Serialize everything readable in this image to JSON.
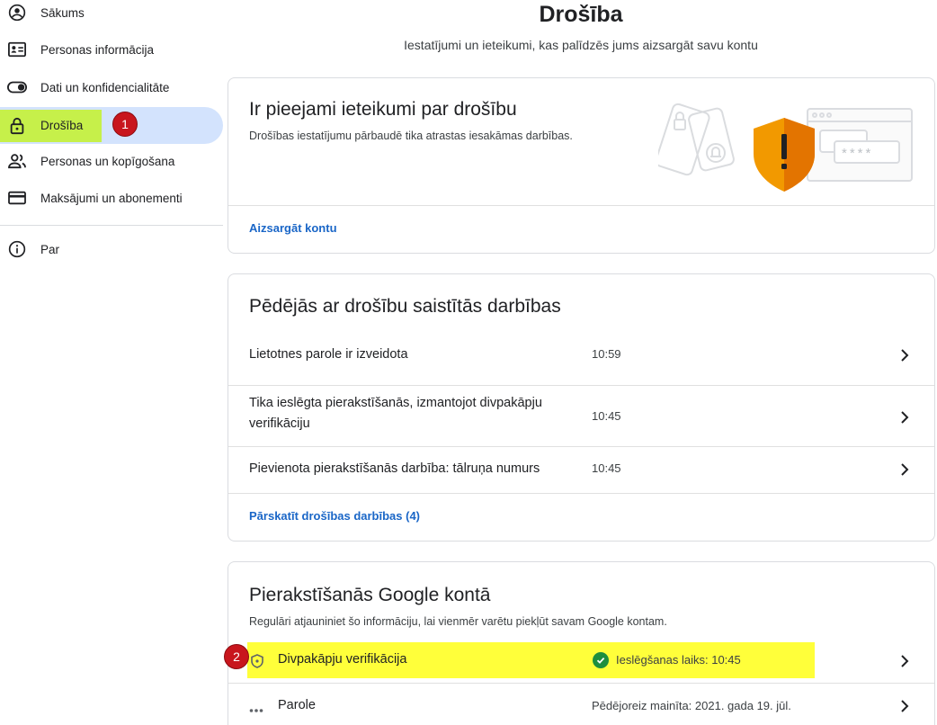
{
  "sidebar": {
    "items": [
      {
        "label": "Sākums",
        "icon": "account-circle-icon"
      },
      {
        "label": "Personas informācija",
        "icon": "id-card-icon"
      },
      {
        "label": "Dati un konfidencialitāte",
        "icon": "toggle-icon"
      },
      {
        "label": "Drošība",
        "icon": "lock-icon",
        "active": true
      },
      {
        "label": "Personas un kopīgošana",
        "icon": "people-icon"
      },
      {
        "label": "Maksājumi un abonementi",
        "icon": "credit-card-icon"
      }
    ],
    "about": {
      "label": "Par",
      "icon": "info-icon"
    }
  },
  "annotations": {
    "badge1": "1",
    "badge2": "2"
  },
  "header": {
    "title": "Drošība",
    "subtitle": "Iestatījumi un ieteikumi, kas palīdzēs jums aizsargāt savu kontu"
  },
  "recommendations_card": {
    "title": "Ir pieejami ieteikumi par drošību",
    "description": "Drošības iestatījumu pārbaudē tika atrastas iesakāmas darbības.",
    "link": "Aizsargāt kontu",
    "illustration_password_mask": "****"
  },
  "activity_card": {
    "title": "Pēdējās ar drošību saistītās darbības",
    "rows": [
      {
        "text": "Lietotnes parole ir izveidota",
        "time": "10:59"
      },
      {
        "text_line1": "Tika ieslēgta pierakstīšanās, izmantojot divpakāpju",
        "text_line2": "verifikāciju",
        "time": "10:45"
      },
      {
        "text": "Pievienota pierakstīšanās darbība: tālruņa numurs",
        "time": "10:45"
      }
    ],
    "link": "Pārskatīt drošības darbības (4)"
  },
  "signin_card": {
    "title": "Pierakstīšanās Google kontā",
    "description": "Regulāri atjauniniet šo informāciju, lai vienmēr varētu piekļūt savam Google kontam.",
    "rows": [
      {
        "label": "Divpakāpju verifikācija",
        "status": "Ieslēgšanas laiks: 10:45",
        "icon": "shield-icon"
      },
      {
        "label": "Parole",
        "status": "Pēdējoreiz mainīta: 2021. gada 19. jūl.",
        "icon": "password-dots-icon"
      }
    ]
  },
  "colors": {
    "accent_link": "#1a66c7",
    "active_nav": "#d3e3fd",
    "highlight_green": "#c6f04a",
    "highlight_yellow": "#ffff3a",
    "badge_red": "#c8161d",
    "success_green": "#1e8e3e",
    "shield_orange": "#f29900"
  }
}
